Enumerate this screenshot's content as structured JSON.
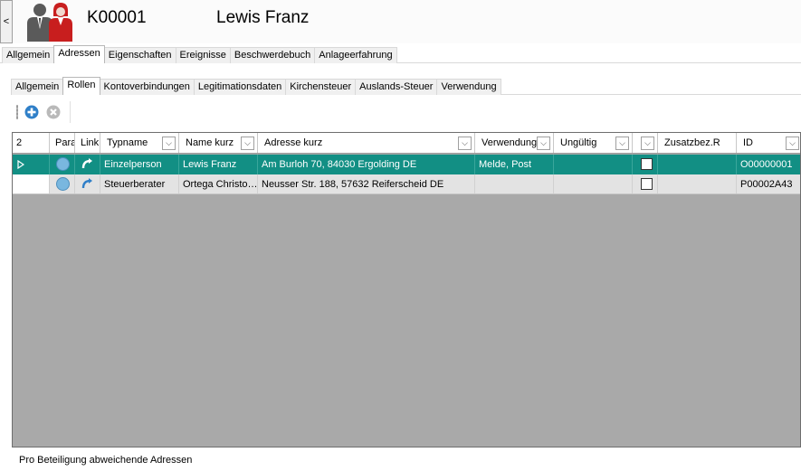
{
  "window": {
    "collapse_label": "<",
    "customer_id": "K00001",
    "customer_name": "Lewis Franz"
  },
  "main_tabs": [
    {
      "label": "Allgemein",
      "active": false
    },
    {
      "label": "Adressen",
      "active": true
    },
    {
      "label": "Eigenschaften",
      "active": false
    },
    {
      "label": "Ereignisse",
      "active": false
    },
    {
      "label": "Beschwerdebuch",
      "active": false
    },
    {
      "label": "Anlageerfahrung",
      "active": false
    }
  ],
  "sub_tabs": [
    {
      "label": "Allgemein",
      "active": false
    },
    {
      "label": "Rollen",
      "active": true
    },
    {
      "label": "Kontoverbindungen",
      "active": false
    },
    {
      "label": "Legitimationsdaten",
      "active": false
    },
    {
      "label": "Kirchensteuer",
      "active": false
    },
    {
      "label": "Auslands-Steuer",
      "active": false
    },
    {
      "label": "Verwendung",
      "active": false
    }
  ],
  "toolbar": {
    "add_icon": "plus-circle-icon",
    "remove_icon": "x-circle-icon"
  },
  "grid": {
    "row_count": "2",
    "columns": [
      "Para",
      "Link",
      "Typname",
      "Name kurz",
      "Adresse kurz",
      "Verwendung",
      "Ungültig",
      "",
      "Zusatzbez.R",
      "ID"
    ],
    "rows": [
      {
        "typname": "Einzelperson",
        "name_kurz": "Lewis Franz",
        "adresse_kurz": "Am Burloh 70, 84030 Ergolding DE",
        "verwendung": "Melde, Post",
        "ungueltig": "",
        "checked": false,
        "zusatzbez": "",
        "id": "O00000001",
        "selected": true
      },
      {
        "typname": "Steuerberater",
        "name_kurz": "Ortega Christo…",
        "adresse_kurz": "Neusser Str. 188, 57632 Reiferscheid DE",
        "verwendung": "",
        "ungueltig": "",
        "checked": false,
        "zusatzbez": "",
        "id": "P00002A43",
        "selected": false
      }
    ]
  },
  "colors": {
    "selected_row": "#128f84",
    "grid_empty": "#a9a9a9",
    "row_normal": "#e3e3e3"
  },
  "status_text": "Pro Beteiligung abweichende Adressen"
}
